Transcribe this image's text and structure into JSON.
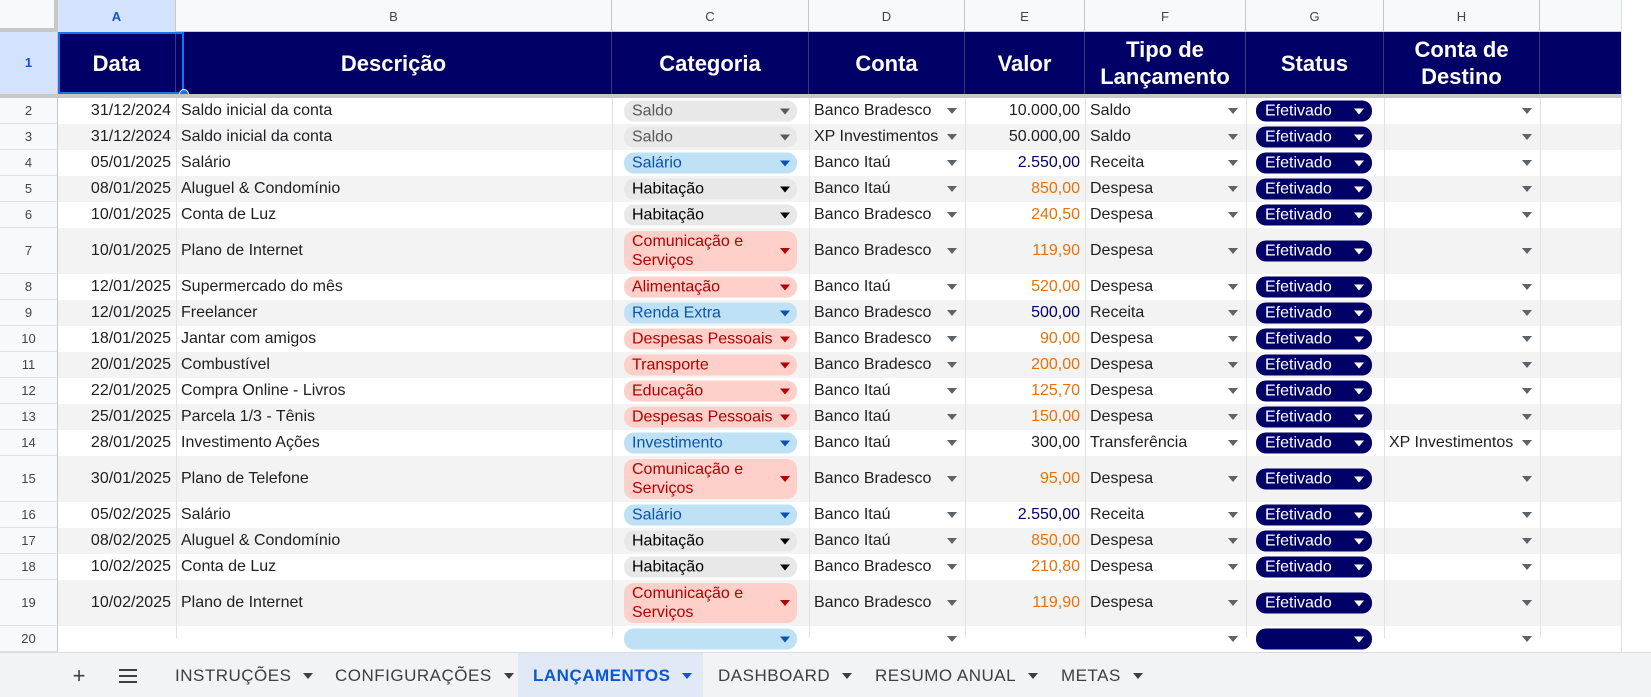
{
  "columns": [
    "A",
    "B",
    "C",
    "D",
    "E",
    "F",
    "G",
    "H"
  ],
  "headers": {
    "data": "Data",
    "descricao": "Descrição",
    "categoria": "Categoria",
    "conta": "Conta",
    "valor": "Valor",
    "tipo": "Tipo de Lançamento",
    "status": "Status",
    "destino": "Conta de Destino"
  },
  "row_numbers": [
    "1",
    "2",
    "3",
    "4",
    "5",
    "6",
    "7",
    "8",
    "9",
    "10",
    "11",
    "12",
    "13",
    "14",
    "15",
    "16",
    "17",
    "18",
    "19",
    "20"
  ],
  "rows": [
    {
      "data": "31/12/2024",
      "desc": "Saldo inicial da conta",
      "cat": "Saldo",
      "cat_style": "gray",
      "conta": "Banco Bradesco",
      "valor": "10.000,00",
      "valor_style": "neutral",
      "tipo": "Saldo",
      "status": "Efetivado",
      "destino": ""
    },
    {
      "data": "31/12/2024",
      "desc": "Saldo inicial da conta",
      "cat": "Saldo",
      "cat_style": "gray",
      "conta": "XP Investimentos",
      "valor": "50.000,00",
      "valor_style": "neutral",
      "tipo": "Saldo",
      "status": "Efetivado",
      "destino": ""
    },
    {
      "data": "05/01/2025",
      "desc": "Salário",
      "cat": "Salário",
      "cat_style": "blue",
      "conta": "Banco Itaú",
      "valor": "2.550,00",
      "valor_style": "income",
      "tipo": "Receita",
      "status": "Efetivado",
      "destino": ""
    },
    {
      "data": "08/01/2025",
      "desc": "Aluguel & Condomínio",
      "cat": "Habitação",
      "cat_style": "dark",
      "conta": "Banco Itaú",
      "valor": "850,00",
      "valor_style": "expense",
      "tipo": "Despesa",
      "status": "Efetivado",
      "destino": ""
    },
    {
      "data": "10/01/2025",
      "desc": "Conta de Luz",
      "cat": "Habitação",
      "cat_style": "dark",
      "conta": "Banco Bradesco",
      "valor": "240,50",
      "valor_style": "expense",
      "tipo": "Despesa",
      "status": "Efetivado",
      "destino": ""
    },
    {
      "data": "10/01/2025",
      "desc": "Plano de Internet",
      "cat": "Comunicação e Serviços",
      "cat_style": "red",
      "conta": "Banco Bradesco",
      "valor": "119,90",
      "valor_style": "expense",
      "tipo": "Despesa",
      "status": "Efetivado",
      "destino": ""
    },
    {
      "data": "12/01/2025",
      "desc": "Supermercado do mês",
      "cat": "Alimentação",
      "cat_style": "red",
      "conta": "Banco Itaú",
      "valor": "520,00",
      "valor_style": "expense",
      "tipo": "Despesa",
      "status": "Efetivado",
      "destino": ""
    },
    {
      "data": "12/01/2025",
      "desc": "Freelancer",
      "cat": "Renda Extra",
      "cat_style": "blue",
      "conta": "Banco Bradesco",
      "valor": "500,00",
      "valor_style": "income",
      "tipo": "Receita",
      "status": "Efetivado",
      "destino": ""
    },
    {
      "data": "18/01/2025",
      "desc": "Jantar com amigos",
      "cat": "Despesas Pessoais",
      "cat_style": "red",
      "conta": "Banco Bradesco",
      "valor": "90,00",
      "valor_style": "expense",
      "tipo": "Despesa",
      "status": "Efetivado",
      "destino": ""
    },
    {
      "data": "20/01/2025",
      "desc": "Combustível",
      "cat": "Transporte",
      "cat_style": "red",
      "conta": "Banco Bradesco",
      "valor": "200,00",
      "valor_style": "expense",
      "tipo": "Despesa",
      "status": "Efetivado",
      "destino": ""
    },
    {
      "data": "22/01/2025",
      "desc": "Compra Online - Livros",
      "cat": "Educação",
      "cat_style": "red",
      "conta": "Banco Itaú",
      "valor": "125,70",
      "valor_style": "expense",
      "tipo": "Despesa",
      "status": "Efetivado",
      "destino": ""
    },
    {
      "data": "25/01/2025",
      "desc": "Parcela 1/3 - Tênis",
      "cat": "Despesas Pessoais",
      "cat_style": "red",
      "conta": "Banco Itaú",
      "valor": "150,00",
      "valor_style": "expense",
      "tipo": "Despesa",
      "status": "Efetivado",
      "destino": ""
    },
    {
      "data": "28/01/2025",
      "desc": "Investimento Ações",
      "cat": "Investimento",
      "cat_style": "blue",
      "conta": "Banco Itaú",
      "valor": "300,00",
      "valor_style": "neutral",
      "tipo": "Transferência",
      "status": "Efetivado",
      "destino": "XP Investimentos"
    },
    {
      "data": "30/01/2025",
      "desc": "Plano de Telefone",
      "cat": "Comunicação e Serviços",
      "cat_style": "red",
      "conta": "Banco Bradesco",
      "valor": "95,00",
      "valor_style": "expense",
      "tipo": "Despesa",
      "status": "Efetivado",
      "destino": ""
    },
    {
      "data": "05/02/2025",
      "desc": "Salário",
      "cat": "Salário",
      "cat_style": "blue",
      "conta": "Banco Itaú",
      "valor": "2.550,00",
      "valor_style": "income",
      "tipo": "Receita",
      "status": "Efetivado",
      "destino": ""
    },
    {
      "data": "08/02/2025",
      "desc": "Aluguel & Condomínio",
      "cat": "Habitação",
      "cat_style": "dark",
      "conta": "Banco Itaú",
      "valor": "850,00",
      "valor_style": "expense",
      "tipo": "Despesa",
      "status": "Efetivado",
      "destino": ""
    },
    {
      "data": "10/02/2025",
      "desc": "Conta de Luz",
      "cat": "Habitação",
      "cat_style": "dark",
      "conta": "Banco Bradesco",
      "valor": "210,80",
      "valor_style": "expense",
      "tipo": "Despesa",
      "status": "Efetivado",
      "destino": ""
    },
    {
      "data": "10/02/2025",
      "desc": "Plano de Internet",
      "cat": "Comunicação e Serviços",
      "cat_style": "red",
      "conta": "Banco Bradesco",
      "valor": "119,90",
      "valor_style": "expense",
      "tipo": "Despesa",
      "status": "Efetivado",
      "destino": ""
    },
    {
      "data": "",
      "desc": "",
      "cat": "",
      "cat_style": "blue",
      "conta": "",
      "valor": "",
      "valor_style": "income",
      "tipo": "",
      "status": "",
      "destino": ""
    }
  ],
  "colors": {
    "header_bg": "#000066",
    "income": "#000066",
    "expense": "#e8710a",
    "chip_gray_bg": "#e8e8e8",
    "chip_gray_fg": "#595959",
    "chip_blue_bg": "#bfe1f6",
    "chip_blue_fg": "#0a53a8",
    "chip_red_bg": "#ffcfc9",
    "chip_red_fg": "#b10202",
    "chip_dark_bg": "#e8e8e8",
    "chip_dark_fg": "#000000"
  },
  "tabbar": {
    "add_icon": "plus-icon",
    "menu_icon": "hamburger-menu-icon",
    "tabs": [
      {
        "label": "INSTRUÇÕES",
        "active": false
      },
      {
        "label": "CONFIGURAÇÕES",
        "active": false
      },
      {
        "label": "LANÇAMENTOS",
        "active": true
      },
      {
        "label": "DASHBOARD",
        "active": false
      },
      {
        "label": "RESUMO ANUAL",
        "active": false
      },
      {
        "label": "METAS",
        "active": false
      }
    ]
  }
}
